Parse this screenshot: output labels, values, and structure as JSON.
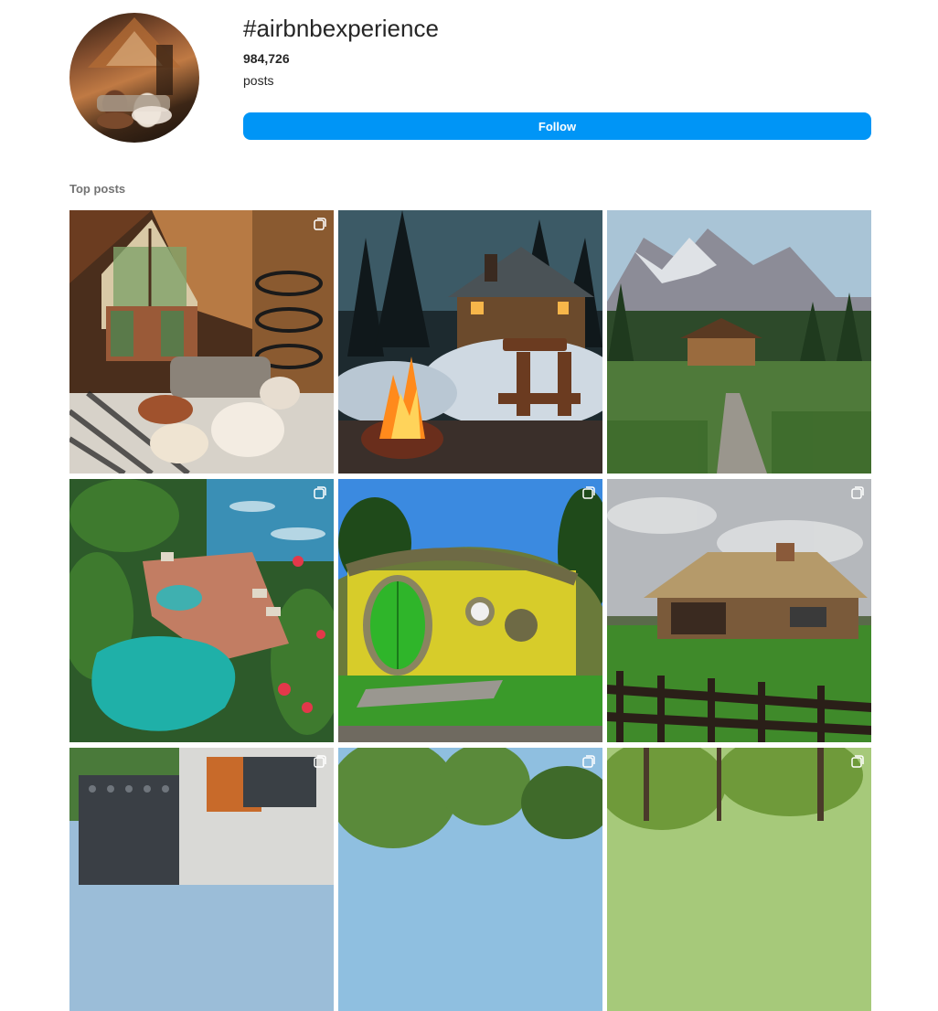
{
  "hashtag": {
    "title": "#airbnbexperience",
    "post_count": "984,726",
    "post_count_label": "posts"
  },
  "actions": {
    "follow_label": "Follow"
  },
  "section": {
    "label": "Top posts"
  },
  "colors": {
    "accent": "#0095f6",
    "text": "#262626",
    "muted": "#737373"
  },
  "posts": [
    {
      "scene": "a-frame-cabin-interior",
      "multi_icon": "carousel-icon"
    },
    {
      "scene": "snowy-cabin-campfire",
      "multi_icon": ""
    },
    {
      "scene": "mountain-log-cabin",
      "multi_icon": ""
    },
    {
      "scene": "tropical-pool-resort",
      "multi_icon": "carousel-icon"
    },
    {
      "scene": "hobbit-house",
      "multi_icon": "carousel-icon"
    },
    {
      "scene": "ranch-cabin-fence",
      "multi_icon": "carousel-icon"
    },
    {
      "scene": "modern-house",
      "multi_icon": "carousel-icon"
    },
    {
      "scene": "forest-river",
      "multi_icon": "carousel-icon"
    },
    {
      "scene": "green-forest",
      "multi_icon": "carousel-icon"
    }
  ]
}
